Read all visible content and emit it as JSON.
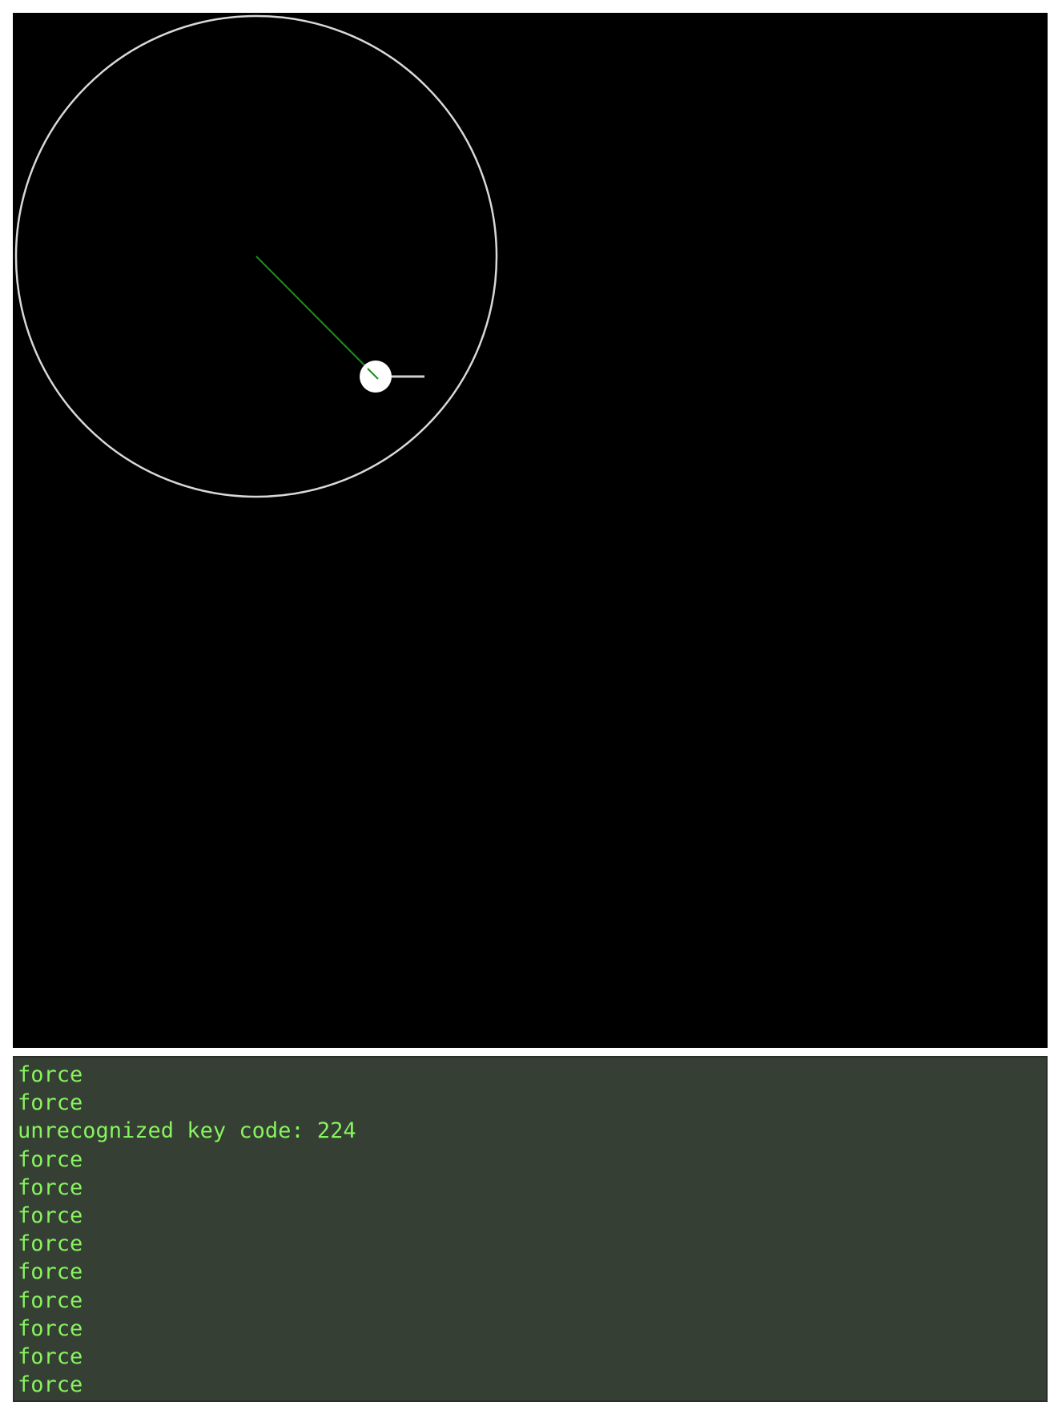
{
  "colors": {
    "canvas_background": "#000000",
    "orbit_stroke": "#d8d8d8",
    "radius_line": "#1f8c1f",
    "ball_fill": "#ffffff",
    "velocity_line": "#cfcfcf",
    "console_background": "#363f34",
    "console_text": "#86f45e"
  },
  "console": {
    "lines": [
      "force",
      "force",
      "unrecognized key code: 224",
      "force",
      "force",
      "force",
      "force",
      "force",
      "force",
      "force",
      "force",
      "force"
    ]
  }
}
